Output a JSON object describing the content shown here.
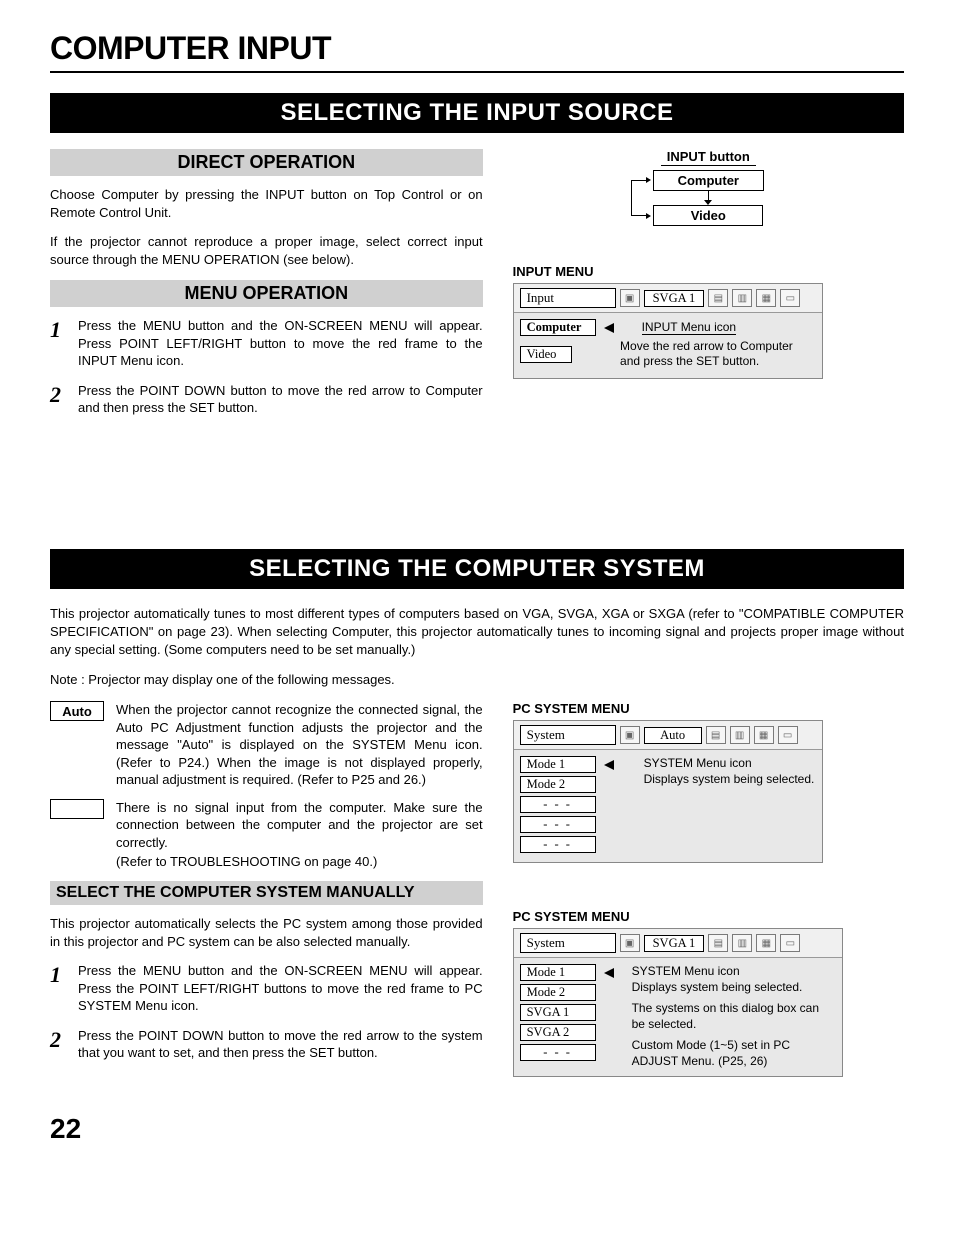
{
  "page_title": "COMPUTER INPUT",
  "page_number": "22",
  "section1": {
    "banner": "SELECTING THE INPUT SOURCE",
    "direct": {
      "heading": "DIRECT OPERATION",
      "p1": "Choose Computer by pressing the INPUT button on Top Control or on Remote Control Unit.",
      "p2": "If the projector cannot reproduce a proper image, select correct input source through the MENU OPERATION (see below)."
    },
    "menu": {
      "heading": "MENU OPERATION",
      "step1": "Press the MENU button and the ON-SCREEN MENU will appear.  Press POINT LEFT/RIGHT button to move the red frame to the INPUT Menu icon.",
      "step2": "Press the POINT DOWN button to move the red arrow to Computer and then press the SET button."
    },
    "diagram": {
      "title": "INPUT button",
      "box1": "Computer",
      "box2": "Video"
    },
    "input_menu": {
      "label": "INPUT MENU",
      "title_cell": "Input",
      "value_cell": "SVGA 1",
      "item1": "Computer",
      "item2": "Video",
      "callout1": "INPUT Menu icon",
      "callout2": "Move the red arrow to Computer and press the SET button."
    }
  },
  "section2": {
    "banner": "SELECTING THE COMPUTER SYSTEM",
    "intro": "This projector automatically tunes to most different types of computers based on VGA, SVGA, XGA or SXGA (refer to \"COMPATIBLE COMPUTER SPECIFICATION\" on page 23).  When selecting Computer, this projector automatically tunes to incoming signal and projects proper image without any special setting.  (Some computers need to be set manually.)",
    "note": "Note : Projector may display one of the following messages.",
    "auto_label": "Auto",
    "auto_text": "When the projector cannot recognize the connected signal, the Auto PC Adjustment function adjusts the projector and the message \"Auto\" is displayed on the SYSTEM Menu icon.  (Refer to P24.)  When the image is not displayed properly, manual adjustment is required.  (Refer to P25 and 26.)",
    "blank_label": "––––",
    "blank_text1": "There is no signal input from the computer.  Make sure the connection between the computer and the projector are set correctly.",
    "blank_text2": "(Refer to TROUBLESHOOTING on page 40.)",
    "manual": {
      "heading": "SELECT THE COMPUTER SYSTEM MANUALLY",
      "p1": "This projector automatically selects the PC system among those provided in this projector and PC system can be also selected manually.",
      "step1": "Press the MENU button and the ON-SCREEN MENU will appear.  Press the POINT LEFT/RIGHT buttons to move the red frame to PC SYSTEM Menu icon.",
      "step2": "Press the POINT DOWN button to move the red arrow to the system that you want to set, and then press the SET button."
    },
    "pc_menu1": {
      "label": "PC SYSTEM MENU",
      "title_cell": "System",
      "value_cell": "Auto",
      "item1": "Mode 1",
      "item2": "Mode 2",
      "dash": "- - -",
      "callout1": "SYSTEM Menu icon",
      "callout2": "Displays system being selected."
    },
    "pc_menu2": {
      "label": "PC SYSTEM MENU",
      "title_cell": "System",
      "value_cell": "SVGA 1",
      "item1": "Mode 1",
      "item2": "Mode 2",
      "item3": "SVGA 1",
      "item4": "SVGA 2",
      "dash": "- - -",
      "callout1": "SYSTEM Menu icon",
      "callout2": "Displays system being selected.",
      "callout3": "The systems on this dialog box can be selected.",
      "callout4": "Custom Mode (1~5) set in PC ADJUST Menu.  (P25, 26)"
    }
  }
}
